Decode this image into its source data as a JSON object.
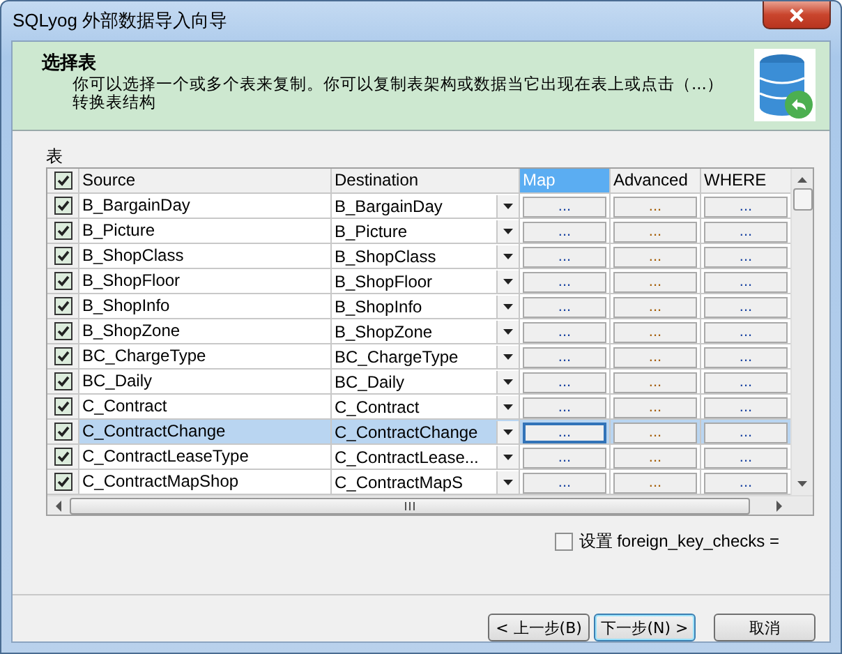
{
  "window": {
    "title": "SQLyog 外部数据导入向导"
  },
  "header": {
    "title": "选择表",
    "description": [
      "你可以选择一个或多个表来复制。你可以复制表架构或数据当它出现在表上或点击（...）",
      "转换表结构"
    ]
  },
  "grid": {
    "label": "表",
    "all_checked": true,
    "columns": [
      {
        "label": "Source",
        "selected": false
      },
      {
        "label": "Destination",
        "selected": false
      },
      {
        "label": "Map",
        "selected": true
      },
      {
        "label": "Advanced",
        "selected": false
      },
      {
        "label": "WHERE",
        "selected": false
      }
    ],
    "rows": [
      {
        "checked": true,
        "source": "B_BargainDay",
        "destination": "B_BargainDay",
        "map": "...",
        "advanced": "...",
        "where": "...",
        "selected": false
      },
      {
        "checked": true,
        "source": "B_Picture",
        "destination": "B_Picture",
        "map": "...",
        "advanced": "...",
        "where": "...",
        "selected": false
      },
      {
        "checked": true,
        "source": "B_ShopClass",
        "destination": "B_ShopClass",
        "map": "...",
        "advanced": "...",
        "where": "...",
        "selected": false
      },
      {
        "checked": true,
        "source": "B_ShopFloor",
        "destination": "B_ShopFloor",
        "map": "...",
        "advanced": "...",
        "where": "...",
        "selected": false
      },
      {
        "checked": true,
        "source": "B_ShopInfo",
        "destination": "B_ShopInfo",
        "map": "...",
        "advanced": "...",
        "where": "...",
        "selected": false
      },
      {
        "checked": true,
        "source": "B_ShopZone",
        "destination": "B_ShopZone",
        "map": "...",
        "advanced": "...",
        "where": "...",
        "selected": false
      },
      {
        "checked": true,
        "source": "BC_ChargeType",
        "destination": "BC_ChargeType",
        "map": "...",
        "advanced": "...",
        "where": "...",
        "selected": false
      },
      {
        "checked": true,
        "source": "BC_Daily",
        "destination": "BC_Daily",
        "map": "...",
        "advanced": "...",
        "where": "...",
        "selected": false
      },
      {
        "checked": true,
        "source": "C_Contract",
        "destination": "C_Contract",
        "map": "...",
        "advanced": "...",
        "where": "...",
        "selected": false
      },
      {
        "checked": true,
        "source": "C_ContractChange",
        "destination": "C_ContractChange",
        "map": "...",
        "advanced": "...",
        "where": "...",
        "selected": true
      },
      {
        "checked": true,
        "source": "C_ContractLeaseType",
        "destination": "C_ContractLease...",
        "map": "...",
        "advanced": "...",
        "where": "...",
        "selected": false
      },
      {
        "checked": true,
        "source": "C_ContractMapShop",
        "destination": "C_ContractMapS",
        "map": "...",
        "advanced": "...",
        "where": "...",
        "selected": false
      }
    ]
  },
  "foreign_key_option": {
    "label": "设置 foreign_key_checks =",
    "checked": false
  },
  "buttons": [
    {
      "label": "< 上一步(B)",
      "default": false
    },
    {
      "label": "下一步(N) >",
      "default": true
    },
    {
      "label": "取消",
      "default": false
    }
  ]
}
